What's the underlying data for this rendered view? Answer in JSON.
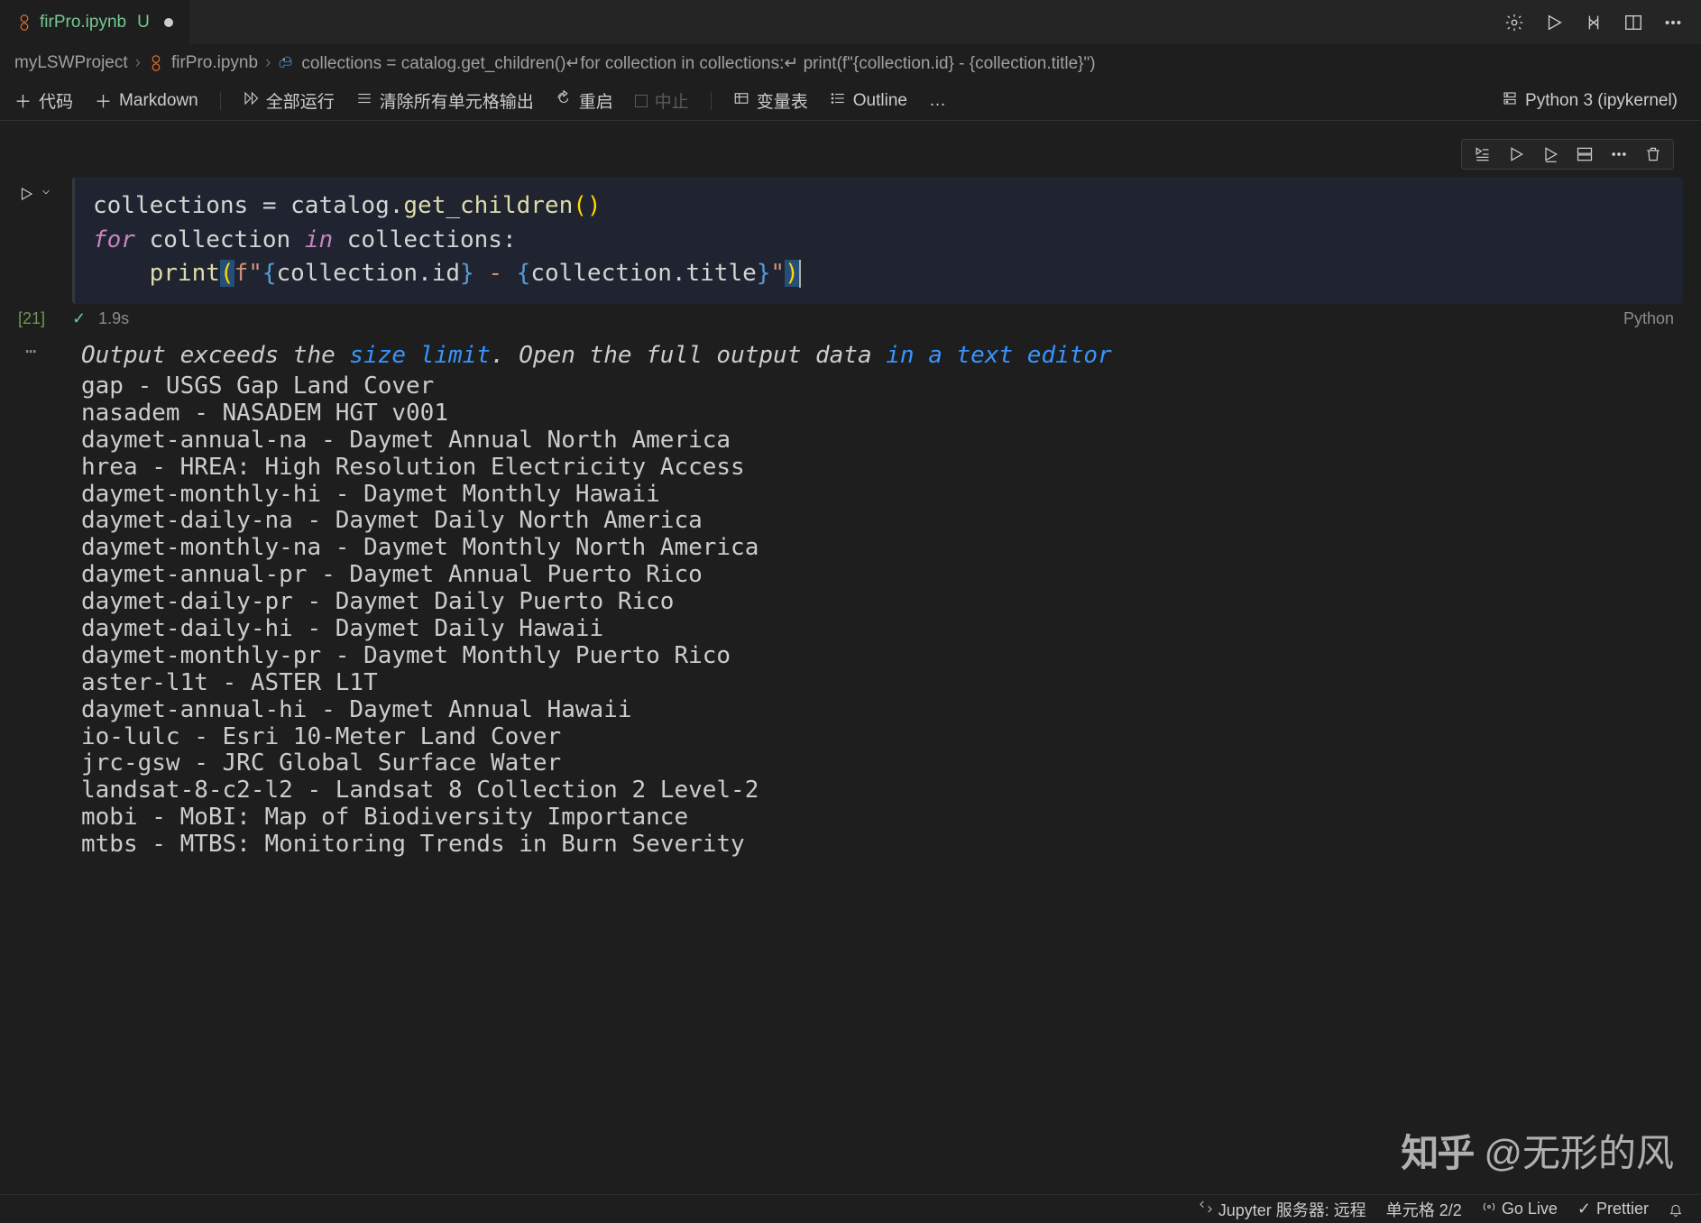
{
  "tab": {
    "filename": "firPro.ipynb",
    "modified_marker": "U"
  },
  "breadcrumb": {
    "project": "myLSWProject",
    "file": "firPro.ipynb",
    "symbol": "collections = catalog.get_children()↵for collection in collections:↵    print(f\"{collection.id} - {collection.title}\")"
  },
  "toolbar": {
    "add_code": "代码",
    "add_markdown": "Markdown",
    "run_all": "全部运行",
    "clear_outputs": "清除所有单元格输出",
    "restart": "重启",
    "interrupt": "中止",
    "variables": "变量表",
    "outline": "Outline",
    "more": "…",
    "kernel": "Python 3 (ipykernel)"
  },
  "cell": {
    "code_tokens": {
      "line1": {
        "var": "collections",
        "assign": " = ",
        "obj": "catalog",
        "dot": ".",
        "method": "get_children",
        "parens": "()"
      },
      "line2": {
        "for": "for",
        "var": " collection ",
        "in": "in",
        "obj": " collections",
        "colon": ":"
      },
      "line3": {
        "indent": "    ",
        "print": "print",
        "lparen": "(",
        "fprefix": "f",
        "q1": "\"",
        "lb1": "{",
        "expr1": "collection.id",
        "rb1": "}",
        "mid": " - ",
        "lb2": "{",
        "expr2": "collection.title",
        "rb2": "}",
        "q2": "\"",
        "rparen": ")"
      }
    },
    "exec_count": "[21]",
    "duration": "1.9s",
    "language": "Python"
  },
  "output": {
    "limit_prefix": "Output exceeds the ",
    "limit_link1": "size limit",
    "limit_mid": ". Open the full output data ",
    "limit_link2": "in a text editor",
    "lines": [
      "gap - USGS Gap Land Cover",
      "nasadem - NASADEM HGT v001",
      "daymet-annual-na - Daymet Annual North America",
      "hrea - HREA: High Resolution Electricity Access",
      "daymet-monthly-hi - Daymet Monthly Hawaii",
      "daymet-daily-na - Daymet Daily North America",
      "daymet-monthly-na - Daymet Monthly North America",
      "daymet-annual-pr - Daymet Annual Puerto Rico",
      "daymet-daily-pr - Daymet Daily Puerto Rico",
      "daymet-daily-hi - Daymet Daily Hawaii",
      "daymet-monthly-pr - Daymet Monthly Puerto Rico",
      "aster-l1t - ASTER L1T",
      "daymet-annual-hi - Daymet Annual Hawaii",
      "io-lulc - Esri 10-Meter Land Cover",
      "jrc-gsw - JRC Global Surface Water",
      "landsat-8-c2-l2 - Landsat 8 Collection 2 Level-2",
      "mobi - MoBI: Map of Biodiversity Importance",
      "mtbs - MTBS: Monitoring Trends in Burn Severity"
    ]
  },
  "statusbar": {
    "jupyter": "Jupyter 服务器: 远程",
    "cell_pos": "单元格 2/2",
    "golive": "Go Live",
    "prettier": "Prettier"
  },
  "watermark": {
    "brand": "知乎",
    "author": "@无形的风"
  }
}
